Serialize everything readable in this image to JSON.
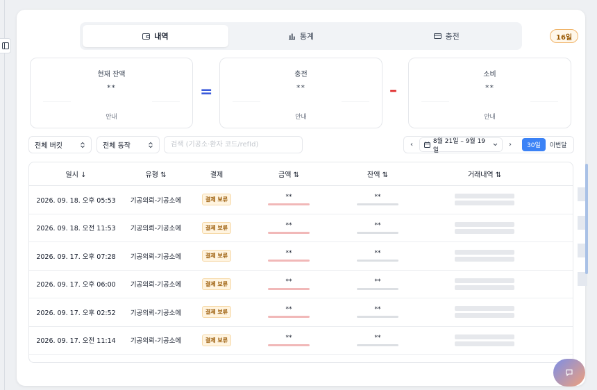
{
  "tabs": [
    {
      "label": "내역",
      "icon": "wallet-icon",
      "active": true
    },
    {
      "label": "통계",
      "icon": "bar-chart-icon",
      "active": false
    },
    {
      "label": "충전",
      "icon": "card-icon",
      "active": false
    }
  ],
  "day_badge": "16일",
  "stats": {
    "balance": {
      "label": "현재 잔액",
      "value": "**",
      "info": "안내"
    },
    "charge": {
      "label": "충전",
      "value": "**",
      "info": "안내"
    },
    "spend": {
      "label": "소비",
      "value": "**",
      "info": "안내"
    },
    "eq": "=",
    "minus": "–"
  },
  "filters": {
    "bucket": "전체 버킷",
    "action": "전체 동작",
    "search_placeholder": "검색 (기공소·환자 코드/refId)"
  },
  "datebar": {
    "prev": "‹",
    "range": "8월 21일 – 9월 19일",
    "next": "›",
    "btn_30": "30일",
    "btn_month": "이번달"
  },
  "table": {
    "headers": [
      "일시 ↓",
      "유형 ⇅",
      "결제",
      "금액 ⇅",
      "잔액 ⇅",
      "거래내역 ⇅"
    ],
    "rows": [
      {
        "date": "2026. 09. 18. 오후 05:53",
        "type": "기공의뢰-기공소에",
        "status": "결제 보류",
        "amount": "**",
        "balance": "**"
      },
      {
        "date": "2026. 09. 18. 오전 11:53",
        "type": "기공의뢰-기공소에",
        "status": "결제 보류",
        "amount": "**",
        "balance": "**"
      },
      {
        "date": "2026. 09. 17. 오후 07:28",
        "type": "기공의뢰-기공소에",
        "status": "결제 보류",
        "amount": "**",
        "balance": "**"
      },
      {
        "date": "2026. 09. 17. 오후 06:00",
        "type": "기공의뢰-기공소에",
        "status": "결제 보류",
        "amount": "**",
        "balance": "**"
      },
      {
        "date": "2026. 09. 17. 오후 02:52",
        "type": "기공의뢰-기공소에",
        "status": "결제 보류",
        "amount": "**",
        "balance": "**"
      },
      {
        "date": "2026. 09. 17. 오전 11:14",
        "type": "기공의뢰-기공소에",
        "status": "결제 보류",
        "amount": "**",
        "balance": "**"
      }
    ]
  },
  "colors": {
    "accent": "#3b82f6",
    "pending_bg": "#fff4e0",
    "pending_fg": "#9a5a05",
    "minus": "#e03131",
    "equals": "#3b5bdb"
  }
}
